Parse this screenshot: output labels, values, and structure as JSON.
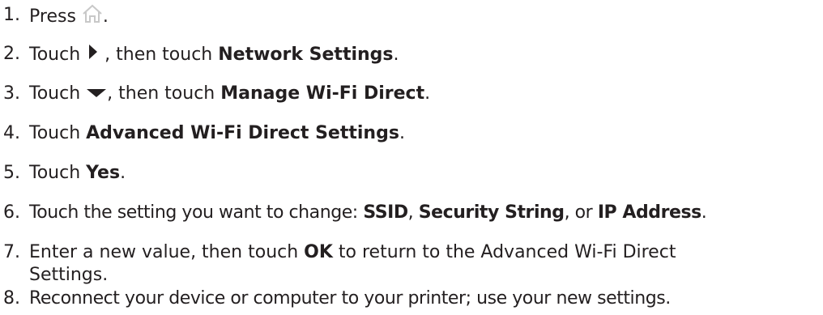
{
  "steps": [
    {
      "num": "1.",
      "pre": "Press ",
      "icon": "home-icon",
      "post": "."
    },
    {
      "num": "2.",
      "pre": "Touch ",
      "icon": "arrow-right-icon",
      "mid": " , then touch ",
      "bold": "Network Settings",
      "post": "."
    },
    {
      "num": "3.",
      "pre": "Touch ",
      "icon": "arrow-down-icon",
      "mid": ", then touch ",
      "bold": "Manage Wi-Fi Direct",
      "post": "."
    },
    {
      "num": "4.",
      "pre": "Touch ",
      "bold": "Advanced Wi-Fi Direct Settings",
      "post": "."
    },
    {
      "num": "5.",
      "pre": "Touch ",
      "bold": "Yes",
      "post": "."
    },
    {
      "num": "6.",
      "pre": "Touch the setting you want to change: ",
      "bold1": "SSID",
      "sep1": ", ",
      "bold2": "Security String",
      "sep2": ", or ",
      "bold3": "IP Address",
      "post": "."
    },
    {
      "num": "7.",
      "pre": "Enter a new value, then touch ",
      "bold": "OK",
      "mid": " to return to the Advanced Wi-Fi Direct",
      "cont": "Settings."
    },
    {
      "num": "8.",
      "text": "Reconnect your device or computer to your printer; use your new settings."
    }
  ]
}
